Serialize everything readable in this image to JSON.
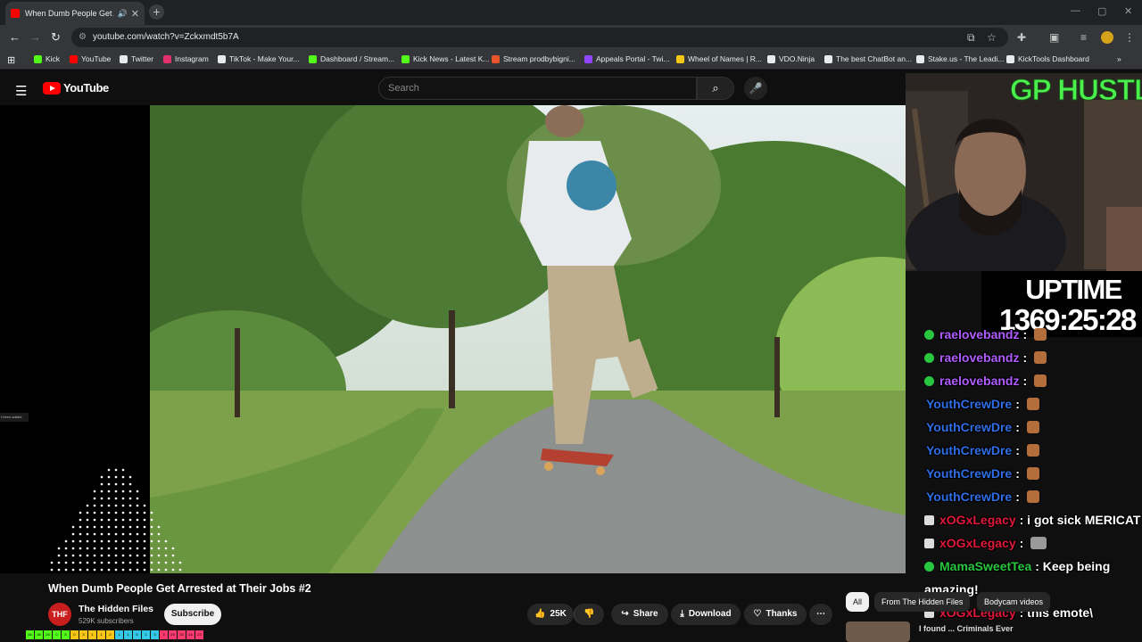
{
  "browser": {
    "tab_title": "When Dumb People Get Ar",
    "url": "youtube.com/watch?v=Zckxmdt5b7A",
    "bookmarks": [
      {
        "label": "Kick",
        "color": "#53fc18"
      },
      {
        "label": "YouTube",
        "color": "#ff0000"
      },
      {
        "label": "Twitter",
        "color": "#e8eaed"
      },
      {
        "label": "Instagram",
        "color": "#e1306c"
      },
      {
        "label": "TikTok - Make Your...",
        "color": "#e8eaed"
      },
      {
        "label": "Dashboard / Stream...",
        "color": "#53fc18"
      },
      {
        "label": "Kick News - Latest K...",
        "color": "#53fc18"
      },
      {
        "label": "Stream prodbybigni...",
        "color": "#e8552a"
      },
      {
        "label": "Appeals Portal - Twi...",
        "color": "#9146ff"
      },
      {
        "label": "Wheel of Names | R...",
        "color": "#f5c518"
      },
      {
        "label": "VDO.Ninja",
        "color": "#e8eaed"
      },
      {
        "label": "The best ChatBot an...",
        "color": "#e8eaed"
      },
      {
        "label": "Stake.us - The Leadi...",
        "color": "#e8eaed"
      },
      {
        "label": "KickTools Dashboard",
        "color": "#e8eaed"
      }
    ]
  },
  "youtube": {
    "logo_text": "YouTube",
    "search_placeholder": "Search",
    "video_title": "When Dumb People Get Arrested at Their Jobs #2",
    "channel_name": "The Hidden Files",
    "subscribers": "529K subscribers",
    "subscribe_label": "Subscribe",
    "likes": "25K",
    "share_label": "Share",
    "download_label": "Download",
    "thanks_label": "Thanks",
    "chips": [
      "All",
      "From The Hidden Files",
      "Bodycam videos"
    ],
    "rec_title": "I found ... Criminals Ever",
    "rec_sub": "Criminals Ever",
    "toast": "t been added"
  },
  "overlay": {
    "brand_text": "GP HUSTLA",
    "uptime_label": "UPTIME",
    "uptime_value": "1369:25:28",
    "chat": [
      {
        "user": "raelovebandz",
        "text": ":",
        "color": "#b05cff",
        "badge": "green",
        "emote": "face"
      },
      {
        "user": "raelovebandz",
        "text": ":",
        "color": "#b05cff",
        "badge": "green",
        "emote": "face"
      },
      {
        "user": "raelovebandz",
        "text": ":",
        "color": "#b05cff",
        "badge": "green",
        "emote": "face"
      },
      {
        "user": "YouthCrewDre",
        "text": ":",
        "color": "#2f6ee6",
        "badge": "",
        "emote": "face"
      },
      {
        "user": "YouthCrewDre",
        "text": ":",
        "color": "#2f6ee6",
        "badge": "",
        "emote": "face"
      },
      {
        "user": "YouthCrewDre",
        "text": ":",
        "color": "#2f6ee6",
        "badge": "",
        "emote": "face"
      },
      {
        "user": "YouthCrewDre",
        "text": ":",
        "color": "#2f6ee6",
        "badge": "",
        "emote": "face"
      },
      {
        "user": "YouthCrewDre",
        "text": ":",
        "color": "#2f6ee6",
        "badge": "",
        "emote": "face"
      },
      {
        "user": "xOGxLegacy",
        "text": ": i got sick MERICAT",
        "color": "#e0193c",
        "badge": "grey",
        "emote": ""
      },
      {
        "user": "xOGxLegacy",
        "text": ":",
        "color": "#e0193c",
        "badge": "grey",
        "emote": "cat"
      },
      {
        "user": "MamaSweetTea",
        "text": ": Keep being",
        "color": "#29c640",
        "badge": "green",
        "emote": ""
      },
      {
        "user": "",
        "text": "amazing!",
        "color": "#ffffff",
        "badge": "",
        "emote": ""
      },
      {
        "user": "xOGxLegacy",
        "text": ": this emote\\",
        "color": "#e0193c",
        "badge": "grey",
        "emote": ""
      }
    ],
    "colorbar": [
      "66",
      "38",
      "25",
      "0",
      "8",
      "0",
      "3",
      "1",
      "1",
      "2",
      "1",
      "1",
      "5",
      "1",
      "3",
      "3",
      "25",
      "33",
      "16",
      "23"
    ]
  }
}
